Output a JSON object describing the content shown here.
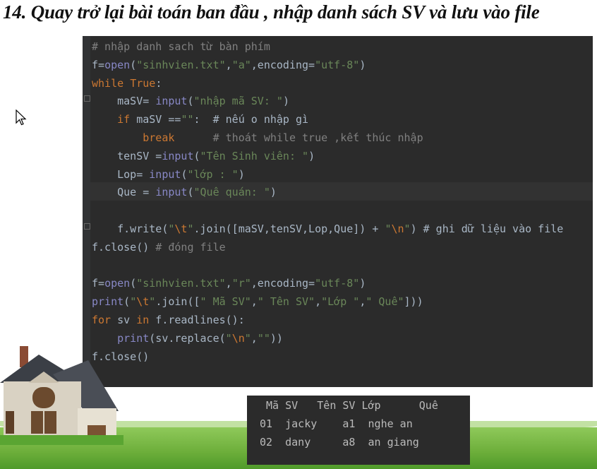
{
  "slide": {
    "title": "14. Quay trở lại bài toán ban đầu , nhập danh sách SV và lưu vào file"
  },
  "code_lines": [
    "# nhập danh sach từ bàn phím",
    "f=open(\"sinhvien.txt\",\"a\",encoding=\"utf-8\")",
    "while True:",
    "    maSV= input(\"nhập mã SV: \")",
    "    if maSV ==\"\":  # nếu o nhập gì",
    "        break      # thoát while true ,kết thúc nhập",
    "    tenSV =input(\"Tên Sinh viên: \")",
    "    Lop= input(\"lớp : \")",
    "    Que = input(\"Quê quán: \")",
    "",
    "    f.write(\"\\t\".join([maSV,tenSV,Lop,Que]) + \"\\n\") # ghi dữ liệu vào file",
    "f.close() # đóng file",
    "",
    "f=open(\"sinhvien.txt\",\"r\",encoding=\"utf-8\")",
    "print(\"\\t\".join([\" Mã SV\",\" Tên SV\",\"Lớp \",\" Quê\"]))",
    "for sv in f.readlines():",
    "    print(sv.replace(\"\\n\",\"\"))",
    "f.close()"
  ],
  "console": {
    "header": " Mã SV   Tên SV Lớp      Quê",
    "rows": [
      "01  jacky    a1  nghe an",
      "02  dany     a8  an giang"
    ]
  },
  "colors": {
    "editor_bg": "#2b2b2b",
    "keyword": "#cc7832",
    "string": "#6a8759",
    "comment": "#808080",
    "builtin": "#8888c6",
    "text": "#a9b7c6"
  }
}
